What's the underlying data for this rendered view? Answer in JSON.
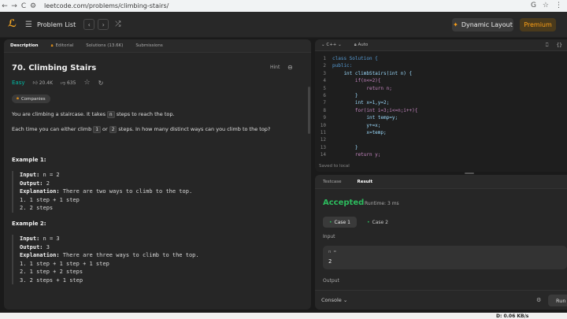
{
  "browser": {
    "url": "leetcode.com/problems/climbing-stairs/",
    "back": "←",
    "forward": "→",
    "reload": "C"
  },
  "header": {
    "problem_list": "Problem List",
    "dynamic_layout": "Dynamic Layout",
    "premium": "Premium"
  },
  "left": {
    "tabs": [
      {
        "label": "Description"
      },
      {
        "label": "Editorial"
      },
      {
        "label": "Solutions (13.6K)"
      },
      {
        "label": "Submissions"
      }
    ],
    "title": "70. Climbing Stairs",
    "hint": "Hint",
    "difficulty": "Easy",
    "likes": "20.4K",
    "dislikes": "635",
    "companies": "Companies",
    "desc1_a": "You are climbing a staircase. It takes ",
    "desc1_code": "n",
    "desc1_b": " steps to reach the top.",
    "desc2_a": "Each time you can either climb ",
    "desc2_code1": "1",
    "desc2_mid": " or ",
    "desc2_code2": "2",
    "desc2_b": " steps. In how many distinct ways can you climb to the top?",
    "examples": [
      {
        "title": "Example 1:",
        "input": "n = 2",
        "output": "2",
        "explanation": "There are two ways to climb to the top.",
        "steps": [
          "1. 1 step + 1 step",
          "2. 2 steps"
        ]
      },
      {
        "title": "Example 2:",
        "input": "n = 3",
        "output": "3",
        "explanation": "There are three ways to climb to the top.",
        "steps": [
          "1. 1 step + 1 step + 1 step",
          "2. 1 step + 2 steps",
          "3. 2 steps + 1 step"
        ]
      }
    ],
    "labels": {
      "input": "Input:",
      "output": "Output:",
      "explanation": "Explanation:"
    }
  },
  "editor": {
    "language": "C++",
    "mode": "Auto",
    "saved": "Saved to local",
    "lines": [
      {
        "n": "1",
        "code": "class Solution {"
      },
      {
        "n": "2",
        "code": "public:"
      },
      {
        "n": "3",
        "code": "    int climbStairs(int n) {"
      },
      {
        "n": "4",
        "code": "        if(n<=2){"
      },
      {
        "n": "5",
        "code": "            return n;"
      },
      {
        "n": "6",
        "code": "        }"
      },
      {
        "n": "7",
        "code": "        int x=1,y=2;"
      },
      {
        "n": "8",
        "code": "        for(int i=3;i<=n;i++){"
      },
      {
        "n": "9",
        "code": "            int temp=y;"
      },
      {
        "n": "10",
        "code": "            y+=x;"
      },
      {
        "n": "11",
        "code": "            x=temp;"
      },
      {
        "n": "12",
        "code": ""
      },
      {
        "n": "13",
        "code": "        }"
      },
      {
        "n": "14",
        "code": "        return y;"
      }
    ]
  },
  "result": {
    "tab_testcase": "Testcase",
    "tab_result": "Result",
    "status": "Accepted",
    "runtime": "Runtime: 3 ms",
    "case1": "Case 1",
    "case2": "Case 2",
    "input_label": "Input",
    "n_label": "n =",
    "n_value": "2",
    "output_label": "Output",
    "console": "Console",
    "run": "Run"
  },
  "taskbar": {
    "net_speed": "D: 0.06 KB/s"
  },
  "colors": {
    "accepted": "#2cbb5d",
    "easy": "#00b8a3",
    "brand": "#ffa116"
  }
}
